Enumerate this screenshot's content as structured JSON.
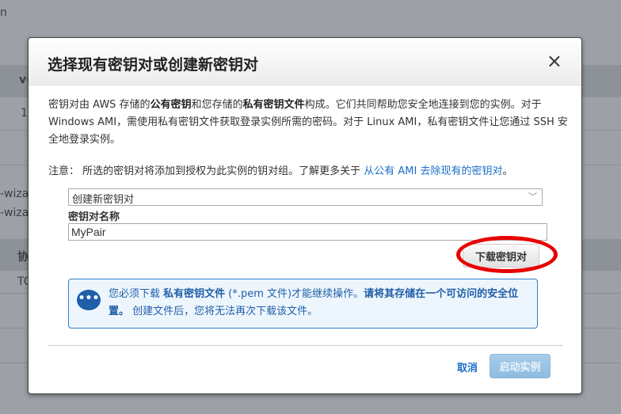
{
  "background": {
    "frag_top": "n",
    "frag_col": "v(",
    "frag_val": "1",
    "frag_wiz1": "-wiza",
    "frag_wiz2": "-wiza",
    "frag_proto": "协",
    "frag_tcp": "TC"
  },
  "dialog": {
    "title": "选择现有密钥对或创建新密钥对",
    "close_icon": "×",
    "intro": {
      "t1": "密钥对由 AWS 存储的",
      "b1": "公有密钥",
      "t2": "和您存储的",
      "b2": "私有密钥文件",
      "t3": "构成。它们共同帮助您安全地连接到您的实例。对于 Windows AMI，需使用私有密钥文件获取登录实例所需的密码。对于 Linux AMI，私有密钥文件让您通过 SSH 安全地登录实例。"
    },
    "note": {
      "text": "注意： 所选的密钥对将添加到授权为此实例的钥对组。了解更多关于 ",
      "link": "从公有 AMI 去除现有的密钥对",
      "end": "。"
    },
    "select_value": "创建新密钥对",
    "name_label": "密钥对名称",
    "name_value": "MyPair",
    "download_label": "下载密钥对",
    "info": {
      "t1": "您必须下载 ",
      "b1": "私有密钥文件",
      "t2": " (*.pem 文件)才能继续操作。",
      "b2": "请将其存储在一个可访问的安全位置。",
      "t3": " 创建文件后，您将无法再次下载该文件。"
    },
    "cancel_label": "取消",
    "launch_label": "启动实例"
  },
  "colors": {
    "accent": "#1a6ec8",
    "highlight": "#e80000"
  }
}
